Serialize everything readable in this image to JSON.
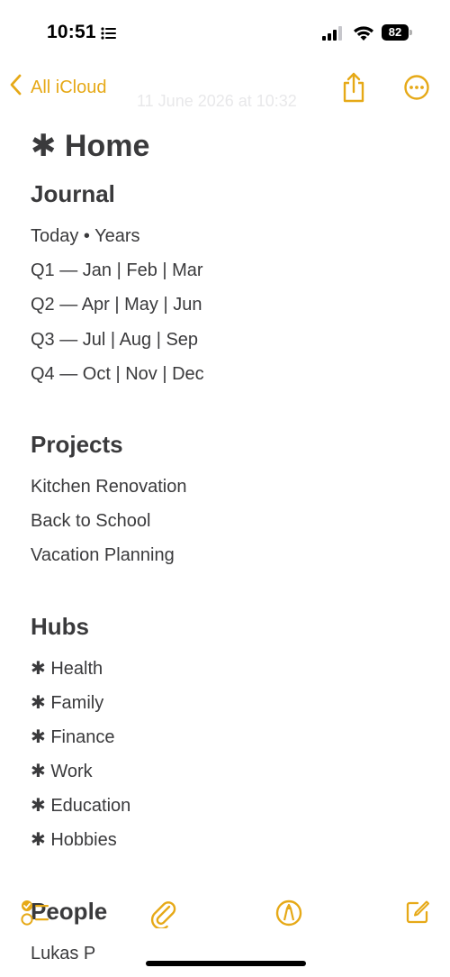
{
  "status_bar": {
    "time": "10:51",
    "battery": "82",
    "focus_icon": "list-icon",
    "signal_icon": "cellular-signal-icon",
    "wifi_icon": "wifi-icon"
  },
  "nav": {
    "back_label": "All iCloud",
    "subtitle": "11 June 2026 at 10:32",
    "back_icon": "chevron-left-icon",
    "share_icon": "share-icon",
    "more_icon": "ellipsis-circle-icon",
    "accent_color": "#e6a917"
  },
  "note": {
    "title": "✱ Home",
    "journal": {
      "heading": "Journal",
      "lines": [
        "Today • Years",
        "Q1 — Jan | Feb | Mar",
        "Q2 — Apr | May | Jun",
        "Q3 — Jul | Aug | Sep",
        "Q4 — Oct | Nov | Dec"
      ]
    },
    "projects": {
      "heading": "Projects",
      "lines": [
        "Kitchen Renovation",
        "Back to School",
        "Vacation Planning"
      ]
    },
    "hubs": {
      "heading": "Hubs",
      "lines": [
        "✱ Health",
        "✱ Family",
        "✱ Finance",
        "✱ Work",
        "✱ Education",
        "✱ Hobbies"
      ]
    },
    "people": {
      "heading": "People",
      "lines": [
        "Lukas P"
      ]
    }
  },
  "toolbar": {
    "checklist_icon": "checklist-icon",
    "attach_icon": "paperclip-icon",
    "markup_icon": "markup-pen-icon",
    "compose_icon": "compose-icon"
  }
}
